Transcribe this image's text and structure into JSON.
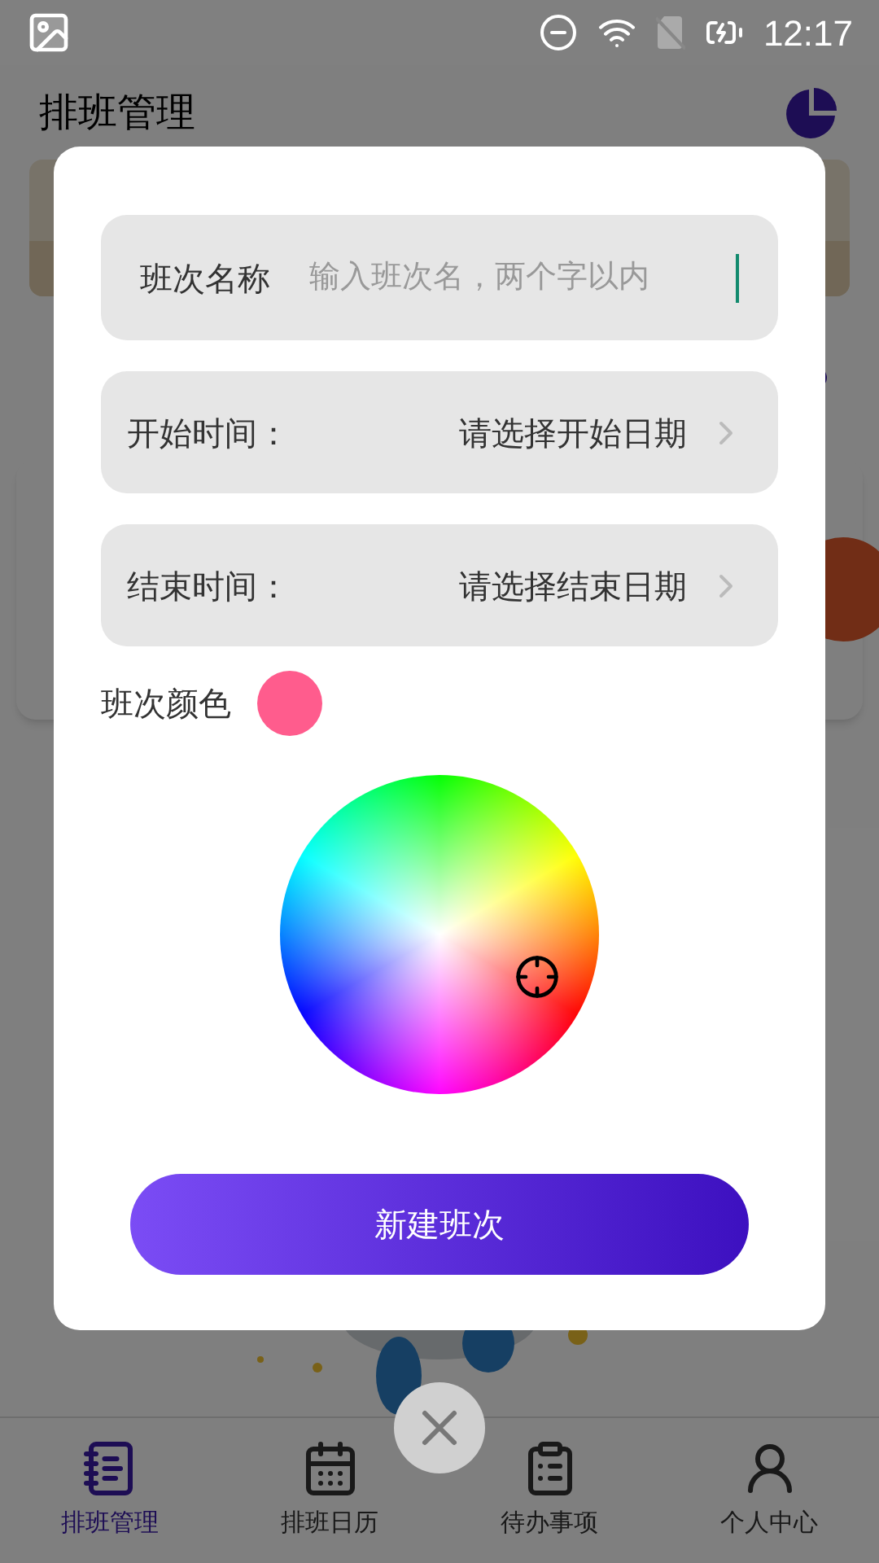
{
  "status_bar": {
    "time": "12:17"
  },
  "header": {
    "title": "排班管理"
  },
  "dialog": {
    "name_field": {
      "label": "班次名称",
      "placeholder": "输入班次名，两个字以内"
    },
    "time_rows": [
      {
        "label": "开始时间：",
        "placeholder": "请选择开始日期"
      },
      {
        "label": "结束时间：",
        "placeholder": "请选择结束日期"
      }
    ],
    "color": {
      "label": "班次颜色",
      "color": "#ff5c8d"
    },
    "submit": "新建班次"
  },
  "bottom_nav": [
    {
      "label": "排班管理",
      "selected": true,
      "kind": "schedule"
    },
    {
      "label": "排班日历",
      "selected": false,
      "kind": "calendar"
    },
    {
      "label": "待办事项",
      "selected": false,
      "kind": "todo"
    },
    {
      "label": "个人中心",
      "selected": false,
      "kind": "profile"
    }
  ]
}
